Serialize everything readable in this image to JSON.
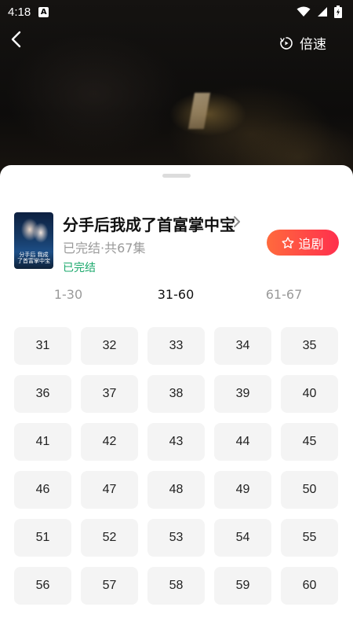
{
  "status_bar": {
    "time": "4:18",
    "notif_letter": "A"
  },
  "player": {
    "speed_label": "倍速"
  },
  "drama": {
    "title": "分手后我成了首富掌中宝",
    "meta": "已完结·共67集",
    "status": "已完结",
    "follow_label": "追剧",
    "poster_text": "分手后 我成了首富掌中宝"
  },
  "tabs": [
    {
      "label": "1-30",
      "active": false
    },
    {
      "label": "31-60",
      "active": true
    },
    {
      "label": "61-67",
      "active": false
    }
  ],
  "episodes": [
    "31",
    "32",
    "33",
    "34",
    "35",
    "36",
    "37",
    "38",
    "39",
    "40",
    "41",
    "42",
    "43",
    "44",
    "45",
    "46",
    "47",
    "48",
    "49",
    "50",
    "51",
    "52",
    "53",
    "54",
    "55",
    "56",
    "57",
    "58",
    "59",
    "60"
  ],
  "colors": {
    "accent_start": "#ff6a3d",
    "accent_end": "#ff2f4d",
    "status_green": "#1aa86b",
    "muted_text": "#9a9a9a",
    "episode_bg": "#f4f4f4"
  }
}
